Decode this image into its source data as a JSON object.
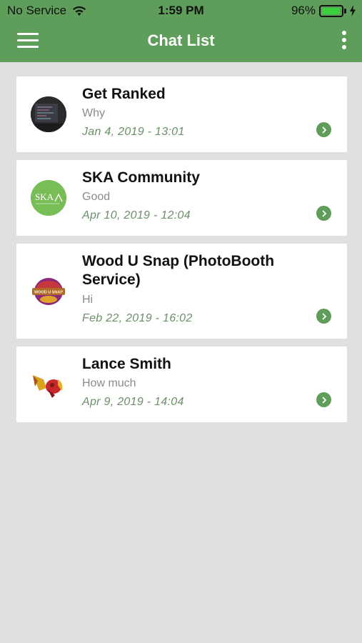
{
  "status_bar": {
    "carrier": "No Service",
    "time": "1:59 PM",
    "battery_percent": "96%",
    "battery_level": 0.96
  },
  "nav": {
    "title": "Chat List",
    "menu_icon": "hamburger-menu-icon",
    "more_icon": "more-vertical-icon"
  },
  "colors": {
    "brand_green": "#5e9e5a",
    "background": "#dfe0e0",
    "date_green": "#6c8f69"
  },
  "chats": [
    {
      "name": "Get Ranked",
      "message": "Why",
      "date": "Jan 4, 2019 - 13:01"
    },
    {
      "name": "SKA Community",
      "message": "Good",
      "date": "Apr 10, 2019 - 12:04",
      "avatar_text": "SKA"
    },
    {
      "name": "Wood U Snap (PhotoBooth Service)",
      "message": "Hi",
      "date": "Feb 22, 2019 - 16:02",
      "avatar_text": "WOOD U SNAP"
    },
    {
      "name": "Lance Smith",
      "message": "How much",
      "date": "Apr 9, 2019 - 14:04"
    }
  ]
}
